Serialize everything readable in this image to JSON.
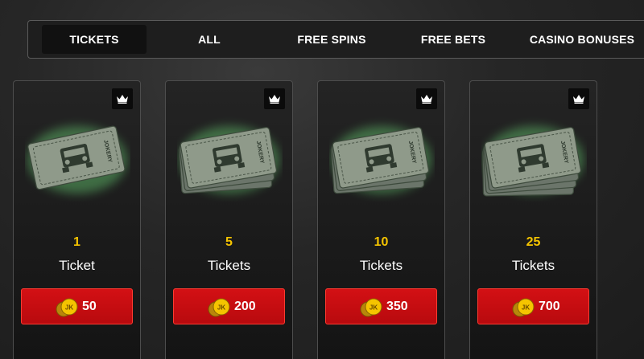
{
  "tabs": [
    {
      "label": "TICKETS",
      "active": true
    },
    {
      "label": "ALL",
      "active": false
    },
    {
      "label": "FREE SPINS",
      "active": false
    },
    {
      "label": "FREE BETS",
      "active": false
    },
    {
      "label": "CASINO BONUSES",
      "active": false
    }
  ],
  "cards": [
    {
      "quantity": "1",
      "unit": "Ticket",
      "price": "50",
      "stack": 1
    },
    {
      "quantity": "5",
      "unit": "Tickets",
      "price": "200",
      "stack": 5
    },
    {
      "quantity": "10",
      "unit": "Tickets",
      "price": "350",
      "stack": 10
    },
    {
      "quantity": "25",
      "unit": "Tickets",
      "price": "700",
      "stack": 25
    }
  ],
  "icons": {
    "badge": "crown-icon",
    "ticket": "jeep-ticket-icon",
    "currency": "jk-coin-icon"
  },
  "ticket_text": "JOKERY",
  "coin_text": "JK",
  "colors": {
    "accent_yellow": "#f5c400",
    "button_red": "#c80c10",
    "glow_green": "#7dff8a"
  }
}
